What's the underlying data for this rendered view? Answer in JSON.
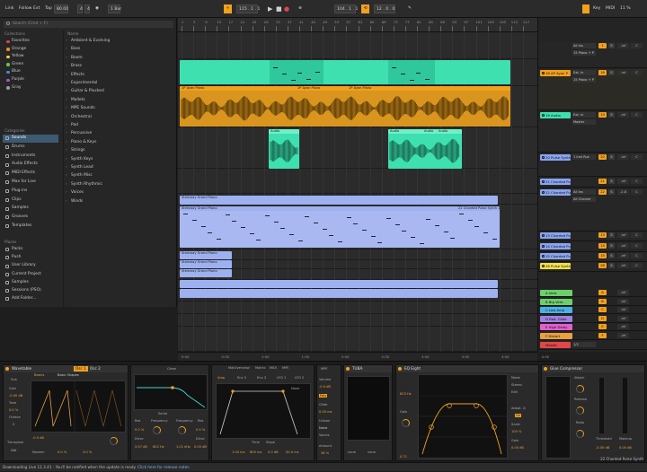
{
  "transport": {
    "link": "Link",
    "follow": "Follow",
    "ext": "Ext",
    "tap": "Tap",
    "tempo": "80.00",
    "sig_num": "4",
    "sig_den": "4",
    "metro_icon": "metronome-icon",
    "quant": "1 Bar",
    "position": "115 . 1 . 1",
    "loop_start": "104 . 1 . 1",
    "loop_len": "12 . 0 . 0",
    "key": "Key",
    "midi": "MIDI",
    "cpu": "11 %"
  },
  "browser": {
    "search": "Search (Cmd + F)",
    "collections_header": "Collections",
    "collections": [
      {
        "label": "Favorites",
        "color": "#e0453b"
      },
      {
        "label": "Orange",
        "color": "#f08a28"
      },
      {
        "label": "Yellow",
        "color": "#e8d23a"
      },
      {
        "label": "Green",
        "color": "#6bc24a"
      },
      {
        "label": "Blue",
        "color": "#3c8ee0"
      },
      {
        "label": "Purple",
        "color": "#a25ad0"
      },
      {
        "label": "Gray",
        "color": "#9a9a9a"
      }
    ],
    "categories_header": "Categories",
    "categories": [
      "Sounds",
      "Drums",
      "Instruments",
      "Audio Effects",
      "MIDI Effects",
      "Max for Live",
      "Plug-ins",
      "Clips",
      "Samples",
      "Grooves",
      "Templates"
    ],
    "places_header": "Places",
    "places": [
      "Packs",
      "Push",
      "User Library",
      "Current Project",
      "Samples",
      "Sessions (PSO)",
      "Add Folder..."
    ],
    "list_header": "Name",
    "list": [
      "Ambient & Evolving",
      "Bass",
      "Boom",
      "Brass",
      "Effects",
      "Experimental",
      "Guitar & Plucked",
      "Mallets",
      "MPE Sounds",
      "Orchestral",
      "Pad",
      "Percussive",
      "Piano & Keys",
      "Strings",
      "Synth Keys",
      "Synth Lead",
      "Synth Misc",
      "Synth Rhythmic",
      "Voices",
      "Winds"
    ]
  },
  "ruler": [
    "1",
    "5",
    "9",
    "13",
    "17",
    "21",
    "25",
    "29",
    "33",
    "37",
    "41",
    "45",
    "49",
    "53",
    "57",
    "61",
    "65",
    "69",
    "73",
    "77",
    "81",
    "85",
    "89",
    "93",
    "97",
    "101",
    "105",
    "109",
    "113",
    "117"
  ],
  "timeline": [
    "0:00",
    "0:30",
    "1:00",
    "1:30",
    "2:00",
    "2:30",
    "3:00",
    "3:30",
    "4:00",
    "4:30"
  ],
  "clips": {
    "piano1": "1P Ayan Piano",
    "piano2": "1P Ayan Piano",
    "piano3": "1P Ayan Piano",
    "audio1": "Audio",
    "audio2": "Audio",
    "audio3": "Audio",
    "audio4": "Audio",
    "grand": "Steinway Grand Piano",
    "grand2": "Steinway Grand Piano",
    "grand3": "Steinway Grand Piano",
    "grand4": "Steinway Grand Piano",
    "grand5": "Steinway Grand Piano",
    "chorded": "22 Chorded Pulse Synth 1"
  },
  "mixer": {
    "set": "Set",
    "tracks": [
      {
        "name": "",
        "color": "#3ee0b0",
        "io": "All Ins",
        "io2": "15 Piano + P",
        "vol": "-inf",
        "pan": "C",
        "num": "1"
      },
      {
        "name": "18 AP Ayan P",
        "color": "#f2a01e",
        "io": "Ext. In",
        "io2": "15 Piano + P",
        "vol": "-inf",
        "pan": "C",
        "num": "18"
      },
      {
        "name": "19 Audio",
        "color": "#3ee0b0",
        "io": "Ext. In",
        "io2": "Master",
        "vol": "-inf",
        "pan": "C",
        "num": "19"
      },
      {
        "name": "20 Pulse Synth",
        "color": "#8aa4f0",
        "io": "1 Inst Rus",
        "io2": "",
        "vol": "-inf",
        "pan": "C",
        "num": "20"
      },
      {
        "name": "21 Chorded Pu",
        "color": "#8aa4f0",
        "io": "",
        "io2": "",
        "vol": "-inf",
        "pan": "C",
        "num": "21"
      },
      {
        "name": "22 Chorded Pu",
        "color": "#8aa4f0",
        "io": "All Ins",
        "io2": "All Channe",
        "vol": "-2.8",
        "pan": "C",
        "num": "22"
      },
      {
        "name": "13 Chorded Pu",
        "color": "#8aa4f0",
        "io": "",
        "io2": "",
        "vol": "-inf",
        "pan": "C",
        "num": "13"
      },
      {
        "name": "14 Chorded Pu",
        "color": "#8aa4f0",
        "io": "",
        "io2": "",
        "vol": "-inf",
        "pan": "C",
        "num": "14"
      },
      {
        "name": "15 Chorded Pu",
        "color": "#8aa4f0",
        "io": "",
        "io2": "",
        "vol": "-inf",
        "pan": "C",
        "num": "15"
      },
      {
        "name": "28 Pulse Synth",
        "color": "#f0e04a",
        "io": "",
        "io2": "",
        "vol": "-inf",
        "pan": "C",
        "num": "28"
      }
    ],
    "returns": [
      {
        "name": "A Verb",
        "color": "#6bd06b"
      },
      {
        "name": "B Big Verb",
        "color": "#6bd06b"
      },
      {
        "name": "C Low Amp",
        "color": "#4ab0e8"
      },
      {
        "name": "D Rad. Glide",
        "color": "#a080e0"
      },
      {
        "name": "E High Delay",
        "color": "#e060d0"
      },
      {
        "name": "F Distort",
        "color": "#e8a040"
      }
    ],
    "master": {
      "name": "Master",
      "color": "#e04848",
      "io": "1/2"
    }
  },
  "devices": {
    "wavetable": {
      "title": "Wavetable",
      "osc1": "Osc 1",
      "osc2": "Osc 2",
      "basics": "Basics",
      "shape": "Basic Shapes",
      "sub": "Sub",
      "gain": "Gain",
      "tone": "Tone",
      "octave": "Octave",
      "transpose": "Transpose",
      "gain_val": "-0.00 dB",
      "tone_val": "0.0 %",
      "oct_val": "0",
      "osc_val": "-0.0 dB",
      "pos": "0.0 %",
      "mod": "Modern",
      "fx_val": "3.0 %"
    },
    "filter": {
      "clean": "Clean",
      "serial": "Serial",
      "res": "Res",
      "freq": "Frequency",
      "drive": "Drive",
      "f1": "802 Hz",
      "f2": "1.01 kHz",
      "r1": "0.0 %",
      "r2": "0.5 %",
      "d1": "2.07 dB",
      "d2": "0.00 dB"
    },
    "mod": {
      "tabs": [
        "MatOverview",
        "Matrix",
        "MIDI",
        "MPE"
      ],
      "amp": "Amp",
      "env2": "Env 2",
      "env3": "Env 3",
      "lfo1": "LFO 1",
      "lfo2": "LFO 2",
      "time": "Time",
      "slope": "Slope",
      "none": "None",
      "t1": "1.00 ms",
      "t2": "600 ms",
      "t3": "0.0 dB",
      "t4": "50.0 ms"
    },
    "voice": {
      "title": "MPE",
      "volume": "Volume",
      "vol_val": "-0.0 dB",
      "poly": "Poly",
      "glide": "Glide",
      "glide_val": "0.00 ms",
      "unison": "Unison",
      "uni_val": "None",
      "voices": "Voices",
      "amount": "Amount",
      "amt_val": "38 %"
    },
    "tuba": {
      "title": "TUBA",
      "none1": "none",
      "none2": "none"
    },
    "eq": {
      "title": "EQ Eight",
      "scale": "Scale",
      "gain": "Gain",
      "mode": "Mode",
      "adapt": "Adapt. Q",
      "stereo": "Stereo",
      "edit": "Edit",
      "oct": "On",
      "freq": "825 Hz",
      "scale_val": "100 %",
      "gain_val": "0.00 dB",
      "q": "0.71"
    },
    "glue": {
      "title": "Glue Compressor",
      "attack": "Attack",
      "release": "Release",
      "ratio": "Ratio",
      "threshold": "Threshold",
      "makeup": "Makeup",
      "dry": "Dry/Wet",
      "th_val": "-0.00 dB",
      "mk_val": "0.00 dB"
    }
  },
  "track_label": "22 Chorded Pulse Synth",
  "status": {
    "text": "Downloading Live 11.3.41 - You'll be notified when the update is ready.",
    "link": "Click here for release notes."
  }
}
